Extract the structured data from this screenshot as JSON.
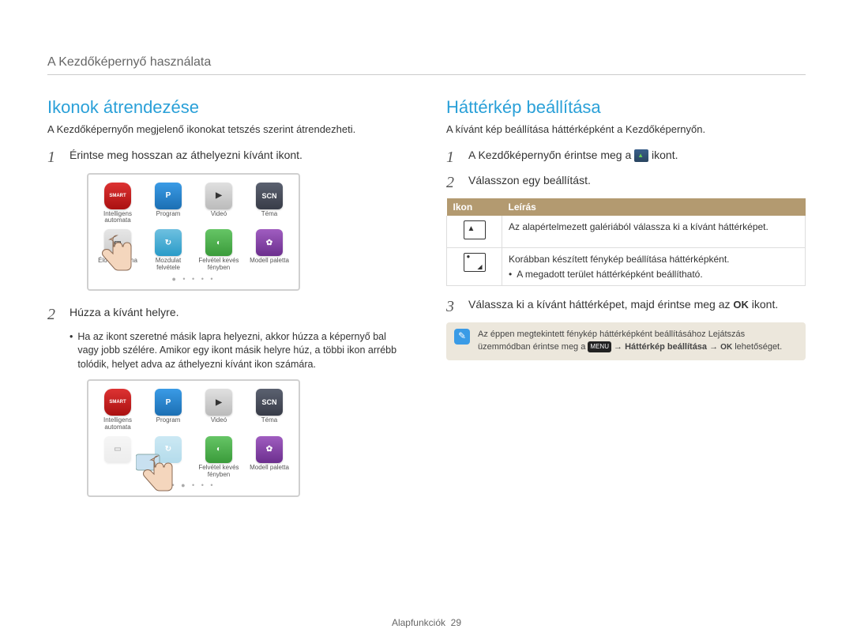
{
  "header": {
    "title": "A Kezdőképernyő használata"
  },
  "left": {
    "title": "Ikonok átrendezése",
    "intro": "A Kezdőképernyőn megjelenő ikonokat tetszés szerint átrendezheti.",
    "step1": "Érintse meg hosszan az áthelyezni kívánt ikont.",
    "step2": "Húzza a kívánt helyre.",
    "bullet2": "Ha az ikont szeretné másik lapra helyezni, akkor húzza a képernyő bal vagy jobb szélére. Amikor egy ikont másik helyre húz, a többi ikon arrébb tolódik, helyet adva az áthelyezni kívánt ikon számára."
  },
  "right": {
    "title": "Háttérkép beállítása",
    "intro": "A kívánt kép beállítása háttérképként a Kezdőképernyőn.",
    "step1_before": "A Kezdőképernyőn érintse meg a",
    "step1_after": "ikont.",
    "step2": "Válasszon egy beállítást.",
    "table": {
      "h1": "Ikon",
      "h2": "Leírás",
      "row1": "Az alapértelmezett galériából válassza ki a kívánt háttérképet.",
      "row2_main": "Korábban készített fénykép beállítása háttérképként.",
      "row2_bullet": "A megadott terület háttérképként beállítható."
    },
    "step3_before": "Válassza ki a kívánt háttérképet, majd érintse meg az",
    "step3_after": "ikont.",
    "note_before": "Az éppen megtekintett fénykép háttérképként beállításához Lejátszás üzemmódban érintse meg a",
    "note_mid1": "Háttérkép beállítása",
    "note_after": "lehetőséget."
  },
  "apps": {
    "smart": "Intelligens automata",
    "program": "Program",
    "video": "Videó",
    "theme": "Téma",
    "pano": "Élő panoráma",
    "gesture": "Mozdulat felvétele",
    "light": "Felvétel kevés fényben",
    "model": "Modell paletta",
    "p_letter": "P",
    "scn": "SCN",
    "smart_letter": "SMART",
    "menu": "MENU"
  },
  "footer": {
    "section": "Alapfunkciók",
    "page": "29"
  },
  "ok_label": "OK"
}
